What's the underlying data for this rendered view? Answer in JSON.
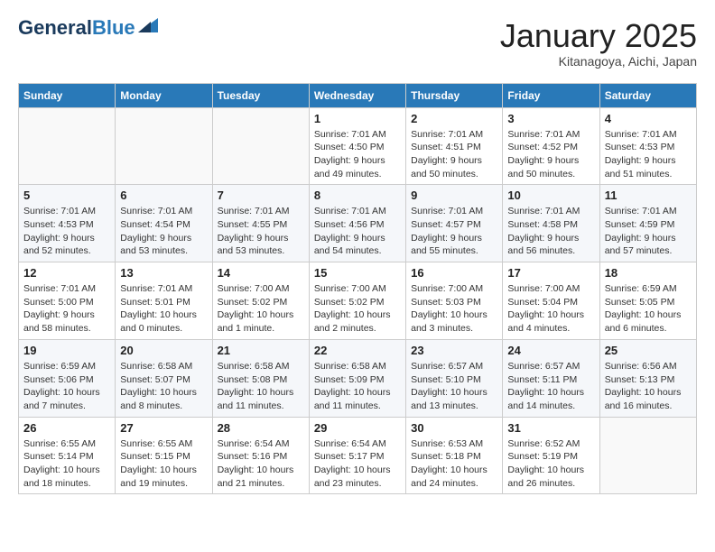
{
  "header": {
    "logo_general": "General",
    "logo_blue": "Blue",
    "month_title": "January 2025",
    "subtitle": "Kitanagoya, Aichi, Japan"
  },
  "days_of_week": [
    "Sunday",
    "Monday",
    "Tuesday",
    "Wednesday",
    "Thursday",
    "Friday",
    "Saturday"
  ],
  "weeks": [
    [
      {
        "day": "",
        "info": ""
      },
      {
        "day": "",
        "info": ""
      },
      {
        "day": "",
        "info": ""
      },
      {
        "day": "1",
        "info": "Sunrise: 7:01 AM\nSunset: 4:50 PM\nDaylight: 9 hours\nand 49 minutes."
      },
      {
        "day": "2",
        "info": "Sunrise: 7:01 AM\nSunset: 4:51 PM\nDaylight: 9 hours\nand 50 minutes."
      },
      {
        "day": "3",
        "info": "Sunrise: 7:01 AM\nSunset: 4:52 PM\nDaylight: 9 hours\nand 50 minutes."
      },
      {
        "day": "4",
        "info": "Sunrise: 7:01 AM\nSunset: 4:53 PM\nDaylight: 9 hours\nand 51 minutes."
      }
    ],
    [
      {
        "day": "5",
        "info": "Sunrise: 7:01 AM\nSunset: 4:53 PM\nDaylight: 9 hours\nand 52 minutes."
      },
      {
        "day": "6",
        "info": "Sunrise: 7:01 AM\nSunset: 4:54 PM\nDaylight: 9 hours\nand 53 minutes."
      },
      {
        "day": "7",
        "info": "Sunrise: 7:01 AM\nSunset: 4:55 PM\nDaylight: 9 hours\nand 53 minutes."
      },
      {
        "day": "8",
        "info": "Sunrise: 7:01 AM\nSunset: 4:56 PM\nDaylight: 9 hours\nand 54 minutes."
      },
      {
        "day": "9",
        "info": "Sunrise: 7:01 AM\nSunset: 4:57 PM\nDaylight: 9 hours\nand 55 minutes."
      },
      {
        "day": "10",
        "info": "Sunrise: 7:01 AM\nSunset: 4:58 PM\nDaylight: 9 hours\nand 56 minutes."
      },
      {
        "day": "11",
        "info": "Sunrise: 7:01 AM\nSunset: 4:59 PM\nDaylight: 9 hours\nand 57 minutes."
      }
    ],
    [
      {
        "day": "12",
        "info": "Sunrise: 7:01 AM\nSunset: 5:00 PM\nDaylight: 9 hours\nand 58 minutes."
      },
      {
        "day": "13",
        "info": "Sunrise: 7:01 AM\nSunset: 5:01 PM\nDaylight: 10 hours\nand 0 minutes."
      },
      {
        "day": "14",
        "info": "Sunrise: 7:00 AM\nSunset: 5:02 PM\nDaylight: 10 hours\nand 1 minute."
      },
      {
        "day": "15",
        "info": "Sunrise: 7:00 AM\nSunset: 5:02 PM\nDaylight: 10 hours\nand 2 minutes."
      },
      {
        "day": "16",
        "info": "Sunrise: 7:00 AM\nSunset: 5:03 PM\nDaylight: 10 hours\nand 3 minutes."
      },
      {
        "day": "17",
        "info": "Sunrise: 7:00 AM\nSunset: 5:04 PM\nDaylight: 10 hours\nand 4 minutes."
      },
      {
        "day": "18",
        "info": "Sunrise: 6:59 AM\nSunset: 5:05 PM\nDaylight: 10 hours\nand 6 minutes."
      }
    ],
    [
      {
        "day": "19",
        "info": "Sunrise: 6:59 AM\nSunset: 5:06 PM\nDaylight: 10 hours\nand 7 minutes."
      },
      {
        "day": "20",
        "info": "Sunrise: 6:58 AM\nSunset: 5:07 PM\nDaylight: 10 hours\nand 8 minutes."
      },
      {
        "day": "21",
        "info": "Sunrise: 6:58 AM\nSunset: 5:08 PM\nDaylight: 10 hours\nand 11 minutes."
      },
      {
        "day": "22",
        "info": "Sunrise: 6:58 AM\nSunset: 5:09 PM\nDaylight: 10 hours\nand 11 minutes."
      },
      {
        "day": "23",
        "info": "Sunrise: 6:57 AM\nSunset: 5:10 PM\nDaylight: 10 hours\nand 13 minutes."
      },
      {
        "day": "24",
        "info": "Sunrise: 6:57 AM\nSunset: 5:11 PM\nDaylight: 10 hours\nand 14 minutes."
      },
      {
        "day": "25",
        "info": "Sunrise: 6:56 AM\nSunset: 5:13 PM\nDaylight: 10 hours\nand 16 minutes."
      }
    ],
    [
      {
        "day": "26",
        "info": "Sunrise: 6:55 AM\nSunset: 5:14 PM\nDaylight: 10 hours\nand 18 minutes."
      },
      {
        "day": "27",
        "info": "Sunrise: 6:55 AM\nSunset: 5:15 PM\nDaylight: 10 hours\nand 19 minutes."
      },
      {
        "day": "28",
        "info": "Sunrise: 6:54 AM\nSunset: 5:16 PM\nDaylight: 10 hours\nand 21 minutes."
      },
      {
        "day": "29",
        "info": "Sunrise: 6:54 AM\nSunset: 5:17 PM\nDaylight: 10 hours\nand 23 minutes."
      },
      {
        "day": "30",
        "info": "Sunrise: 6:53 AM\nSunset: 5:18 PM\nDaylight: 10 hours\nand 24 minutes."
      },
      {
        "day": "31",
        "info": "Sunrise: 6:52 AM\nSunset: 5:19 PM\nDaylight: 10 hours\nand 26 minutes."
      },
      {
        "day": "",
        "info": ""
      }
    ]
  ]
}
